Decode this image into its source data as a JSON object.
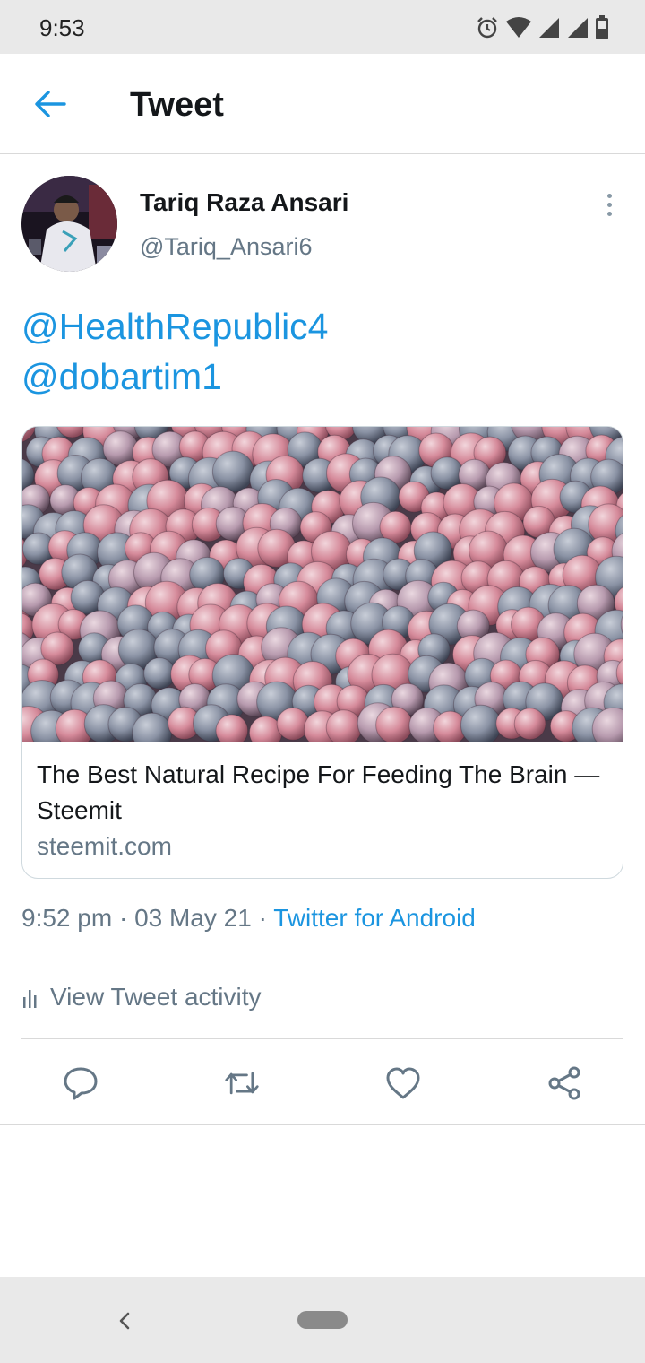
{
  "status_bar": {
    "time": "9:53",
    "icons": [
      "alarm-icon",
      "wifi-icon",
      "signal-icon",
      "signal-icon",
      "battery-icon"
    ]
  },
  "header": {
    "back_icon": "arrow-left-icon",
    "title": "Tweet"
  },
  "tweet": {
    "author_name": "Tariq Raza Ansari",
    "author_handle": "@Tariq_Ansari6",
    "more_icon": "more-vertical-icon",
    "mentions": [
      "@HealthRepublic4",
      "@dobartim1"
    ],
    "card": {
      "title": "The Best Natural Recipe For Feeding The Brain — Steemit",
      "domain": "steemit.com"
    },
    "time": "9:52 pm",
    "date": "03 May 21",
    "source": "Twitter for Android",
    "activity_label": "View Tweet activity"
  },
  "actions": [
    "reply-icon",
    "retweet-icon",
    "like-icon",
    "share-icon"
  ],
  "colors": {
    "accent": "#1b95e0",
    "secondary_text": "#657786",
    "primary_text": "#14171a",
    "divider": "#d9d9d9",
    "system_bar": "#e9e9e9"
  }
}
